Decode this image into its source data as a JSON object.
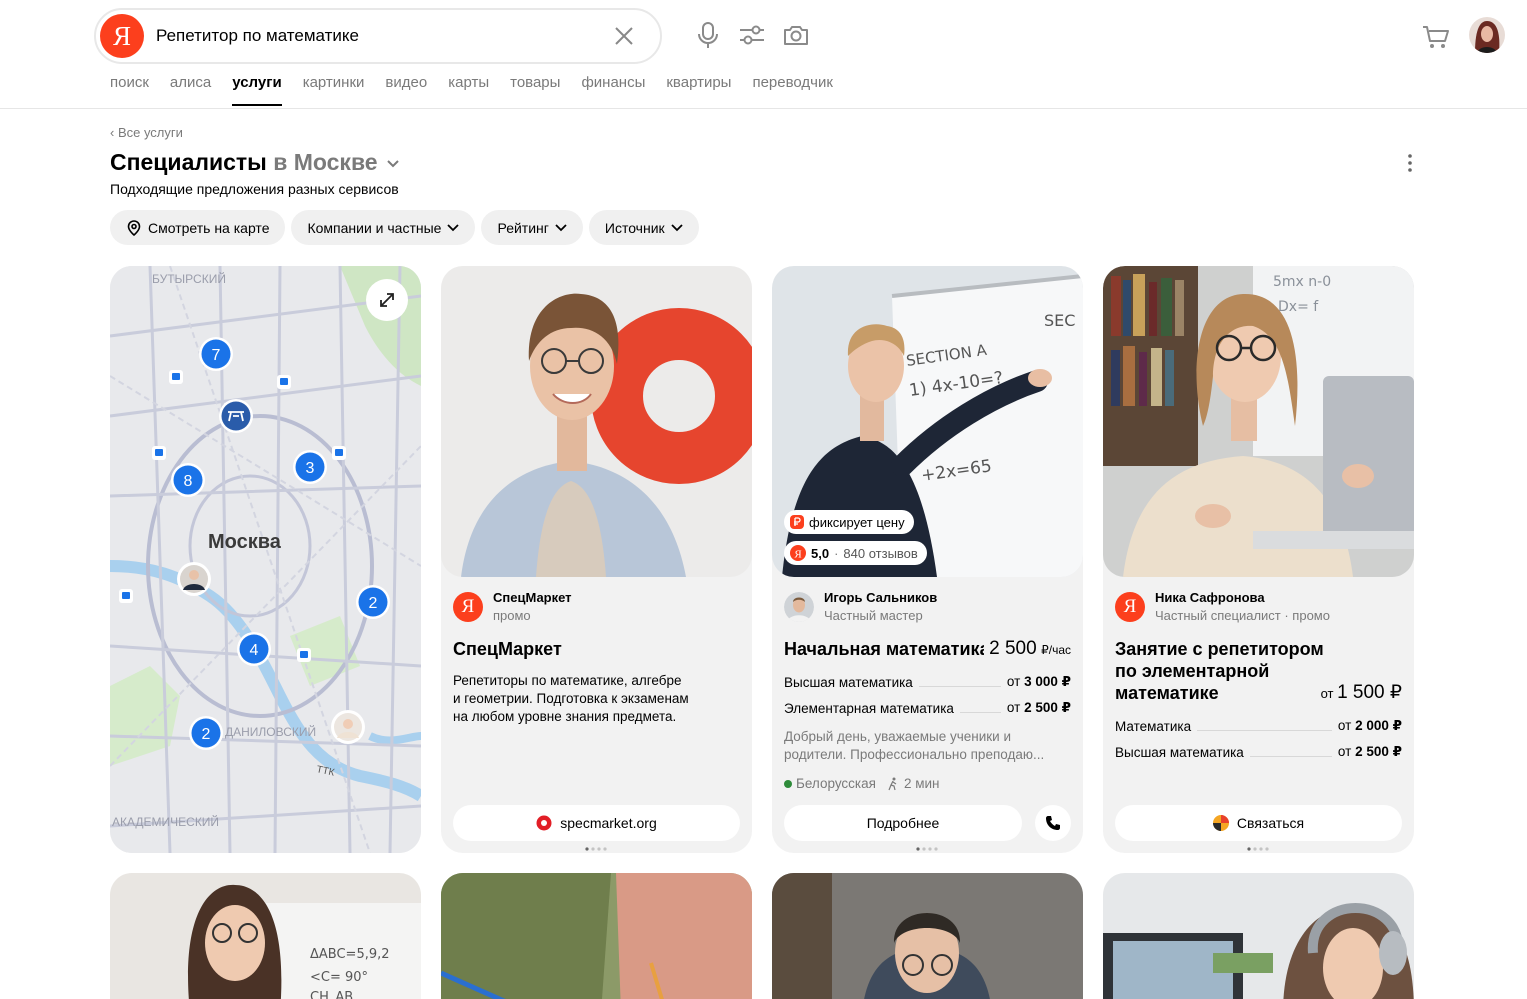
{
  "search": {
    "query": "Репетитор по математике",
    "logo_letter": "Я"
  },
  "tabs": [
    "поиск",
    "алиса",
    "услуги",
    "картинки",
    "видео",
    "карты",
    "товары",
    "финансы",
    "квартиры",
    "переводчик"
  ],
  "active_tab": "услуги",
  "page": {
    "back": "‹ Все услуги",
    "title_main": "Специалисты",
    "title_city": " в Москве",
    "subtitle": "Подходящие предложения разных сервисов"
  },
  "filters": {
    "map": "Смотреть на карте",
    "type": "Компании и частные",
    "rating": "Рейтинг",
    "source": "Источник"
  },
  "map": {
    "city": "Москва",
    "district_1": "БУТЫРСКИЙ",
    "district_2": "ДАНИЛОВСКИЙ",
    "district_3": "АКАДЕМИЧЕСКИЙ",
    "ring_label": "ТТК",
    "clusters": [
      "7",
      "3",
      "8",
      "2",
      "4",
      "2"
    ]
  },
  "cards": [
    {
      "provider": "СпецМаркет",
      "provider_sub": "промо",
      "title": "СпецМаркет",
      "desc_1": "Репетиторы по математике, алгебре",
      "desc_2": "и геометрии. Подготовка к экзаменам",
      "desc_3": "на любом уровне знания предмета.",
      "button": "specmarket.org"
    },
    {
      "badge_fixed": "фиксирует цену",
      "rating": "5,0",
      "reviews": "840 отзывов",
      "provider": "Игорь Сальников",
      "provider_sub": "Частный мастер",
      "title": "Начальная математика",
      "price": "2 500",
      "price_unit": "₽/час",
      "rows": [
        {
          "label": "Высшая математика",
          "prefix": "от ",
          "value": "3 000 ₽"
        },
        {
          "label": "Элементарная математика",
          "prefix": "от ",
          "value": "2 500 ₽"
        }
      ],
      "desc_1": "Добрый день, уважаемые ученики и",
      "desc_2": "родители. Профессионально преподаю...",
      "metro": "Белорусская",
      "walk": "2 мин",
      "button": "Подробнее"
    },
    {
      "provider": "Ника Сафронова",
      "provider_sub": "Частный специалист · промо",
      "title_1": "Занятие с репетитором",
      "title_2": "по элементарной",
      "title_3": "математике",
      "price_prefix": "от ",
      "price": "1 500 ₽",
      "rows": [
        {
          "label": "Математика",
          "prefix": "от ",
          "value": "2 000 ₽"
        },
        {
          "label": "Высшая математика",
          "prefix": "от ",
          "value": "2 500 ₽"
        }
      ],
      "button": "Связаться"
    }
  ],
  "colors": {
    "brand_red": "#fc3f1d",
    "map_pin": "#1a73e8",
    "card_bg": "#f2f2f2"
  }
}
